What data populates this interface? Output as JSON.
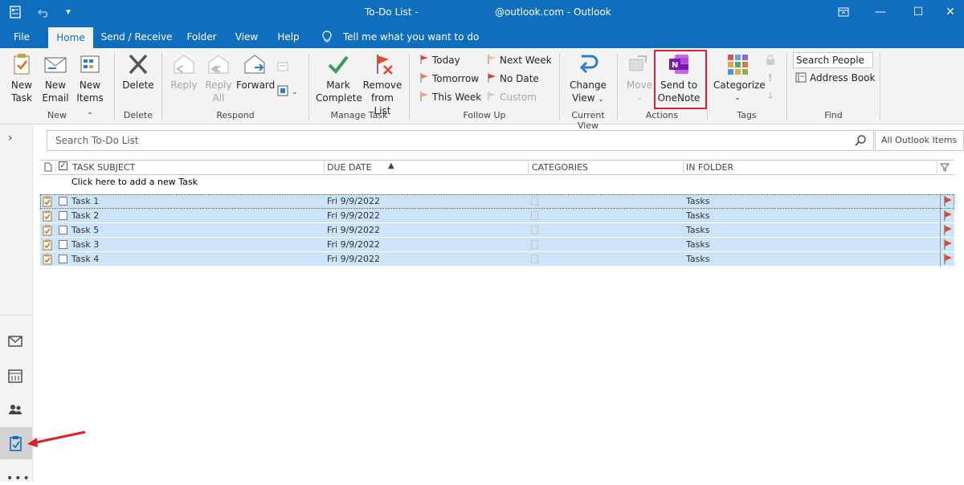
{
  "titlebar": {
    "title_left": "To-Do List -",
    "title_right": "@outlook.com  -  Outlook"
  },
  "menu": {
    "tabs": [
      {
        "label": "File"
      },
      {
        "label": "Home"
      },
      {
        "label": "Send / Receive"
      },
      {
        "label": "Folder"
      },
      {
        "label": "View"
      },
      {
        "label": "Help"
      }
    ],
    "tell_me": "Tell me what you want to do"
  },
  "ribbon": {
    "new_task": "New Task",
    "new_task_l1": "New",
    "new_task_l2": "Task",
    "new_email_l1": "New",
    "new_email_l2": "Email",
    "new_items_l1": "New",
    "new_items_l2": "Items",
    "group_new": "New",
    "delete": "Delete",
    "group_delete": "Delete",
    "reply": "Reply",
    "reply_all_l1": "Reply",
    "reply_all_l2": "All",
    "forward": "Forward",
    "group_respond": "Respond",
    "mark_complete_l1": "Mark",
    "mark_complete_l2": "Complete",
    "remove_l1": "Remove",
    "remove_l2": "from List",
    "group_manage": "Manage Task",
    "today": "Today",
    "tomorrow": "Tomorrow",
    "this_week": "This Week",
    "next_week": "Next Week",
    "no_date": "No Date",
    "custom": "Custom",
    "group_followup": "Follow Up",
    "change_view_l1": "Change",
    "change_view_l2": "View",
    "group_current_view": "Current View",
    "move": "Move",
    "send_onenote_l1": "Send to",
    "send_onenote_l2": "OneNote",
    "group_actions": "Actions",
    "categorize": "Categorize",
    "group_tags": "Tags",
    "search_people": "Search People",
    "address_book": "Address Book",
    "group_find": "Find"
  },
  "search": {
    "placeholder": "Search To-Do List",
    "scope": "All Outlook Items"
  },
  "table": {
    "headers": {
      "subject": "TASK SUBJECT",
      "due": "DUE DATE",
      "categories": "CATEGORIES",
      "folder": "IN FOLDER"
    },
    "add_task": "Click here to add a new Task",
    "rows": [
      {
        "subject": "Task 1",
        "due": "Fri 9/9/2022",
        "folder": "Tasks"
      },
      {
        "subject": "Task 2",
        "due": "Fri 9/9/2022",
        "folder": "Tasks"
      },
      {
        "subject": "Task 5",
        "due": "Fri 9/9/2022",
        "folder": "Tasks"
      },
      {
        "subject": "Task 3",
        "due": "Fri 9/9/2022",
        "folder": "Tasks"
      },
      {
        "subject": "Task 4",
        "due": "Fri 9/9/2022",
        "folder": "Tasks"
      }
    ]
  },
  "colors": {
    "brand": "#106ebe",
    "selection": "#cce4f7",
    "highlight_box": "#d9232e",
    "flag": "#e04a2f"
  }
}
